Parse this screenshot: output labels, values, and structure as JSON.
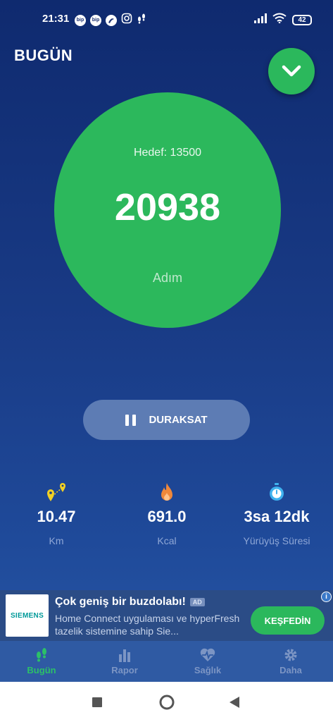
{
  "status_bar": {
    "time": "21:31",
    "notification_icons": [
      "bip-icon",
      "bip-icon",
      "turkcell-icon",
      "instagram-icon",
      "footsteps-icon"
    ],
    "battery": "42"
  },
  "header": {
    "title": "BUGÜN"
  },
  "goal": {
    "target_label": "Hedef: 13500",
    "steps": "20938",
    "unit": "Adım"
  },
  "pause_button": {
    "label": "DURAKSAT"
  },
  "stats": [
    {
      "icon": "distance-icon",
      "value": "10.47",
      "label": "Km"
    },
    {
      "icon": "flame-icon",
      "value": "691.0",
      "label": "Kcal"
    },
    {
      "icon": "stopwatch-icon",
      "value": "3sa 12dk",
      "label": "Yürüyüş Süresi"
    }
  ],
  "ad": {
    "logo": "SIEMENS",
    "title": "Çok geniş bir buzdolabı!",
    "tag": "AD",
    "description": "Home Connect uygulaması ve hyperFresh tazelik sistemine sahip Sie...",
    "cta": "KEŞFEDİN"
  },
  "bottom_nav": [
    {
      "label": "Bugün",
      "icon": "footsteps-icon",
      "active": true
    },
    {
      "label": "Rapor",
      "icon": "bar-chart-icon",
      "active": false
    },
    {
      "label": "Sağlık",
      "icon": "heart-pulse-icon",
      "active": false
    },
    {
      "label": "Daha",
      "icon": "gear-icon",
      "active": false
    }
  ],
  "colors": {
    "accent_green": "#2cb85c",
    "background_top": "#0f2a6f",
    "background_bottom": "#2a5aa8",
    "distance_icon": "#f2d024",
    "flame_icon": "#f0883a",
    "stopwatch_icon": "#3fb2ef"
  }
}
